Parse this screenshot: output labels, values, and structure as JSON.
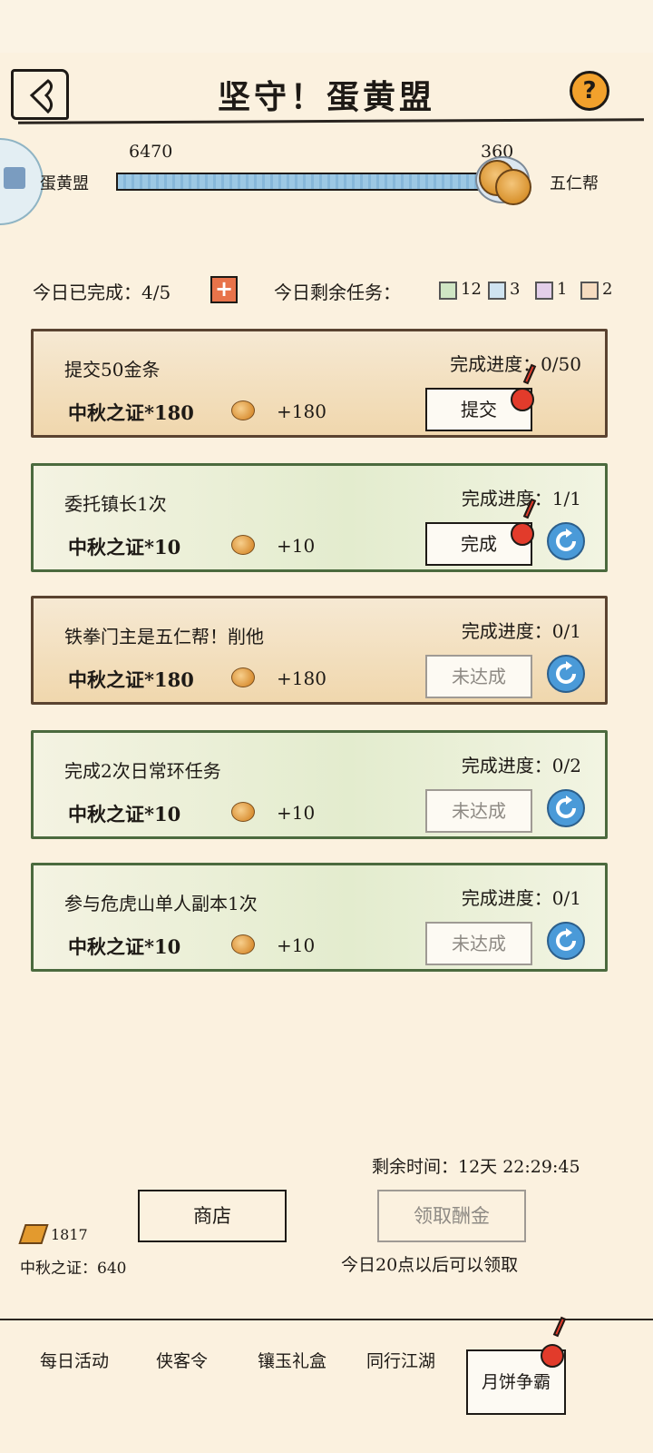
{
  "header": {
    "title": "坚守！蛋黄盟"
  },
  "battle": {
    "left_team": "蛋黄盟",
    "right_team": "五仁帮",
    "left_score": "6470",
    "right_score": "360",
    "progress": 0.947
  },
  "status": {
    "completed_label": "今日已完成：4/5",
    "remaining_label": "今日剩余任务：",
    "counts": [
      "12",
      "3",
      "1",
      "2"
    ],
    "chip_colors": [
      "#cfe6c4",
      "#cfe3f0",
      "#e3cfe9",
      "#f6dcc0"
    ]
  },
  "tasks": [
    {
      "name": "提交50金条",
      "reward": "中秋之证*180",
      "bonus": "+180",
      "progress": "完成进度：0/50",
      "action": "提交",
      "theme": "orange",
      "enabled": true,
      "alert": true,
      "refresh": false
    },
    {
      "name": "委托镇长1次",
      "reward": "中秋之证*10",
      "bonus": "+10",
      "progress": "完成进度：1/1",
      "action": "完成",
      "theme": "green",
      "enabled": true,
      "alert": true,
      "refresh": true
    },
    {
      "name": "铁拳门主是五仁帮！削他",
      "reward": "中秋之证*180",
      "bonus": "+180",
      "progress": "完成进度：0/1",
      "action": "未达成",
      "theme": "orange",
      "enabled": false,
      "alert": false,
      "refresh": true
    },
    {
      "name": "完成2次日常环任务",
      "reward": "中秋之证*10",
      "bonus": "+10",
      "progress": "完成进度：0/2",
      "action": "未达成",
      "theme": "green",
      "enabled": false,
      "alert": false,
      "refresh": true
    },
    {
      "name": "参与危虎山单人副本1次",
      "reward": "中秋之证*10",
      "bonus": "+10",
      "progress": "完成进度：0/1",
      "action": "未达成",
      "theme": "green",
      "enabled": false,
      "alert": false,
      "refresh": true
    }
  ],
  "footer": {
    "remaining_time": "剩余时间：12天 22:29:45",
    "shop": "商店",
    "claim": "领取酬金",
    "gold_count": "1817",
    "token_label": "中秋之证：640",
    "claim_note": "今日20点以后可以领取"
  },
  "tabs": [
    "每日活动",
    "侠客令",
    "镶玉礼盒",
    "同行江湖",
    "月饼争霸"
  ]
}
